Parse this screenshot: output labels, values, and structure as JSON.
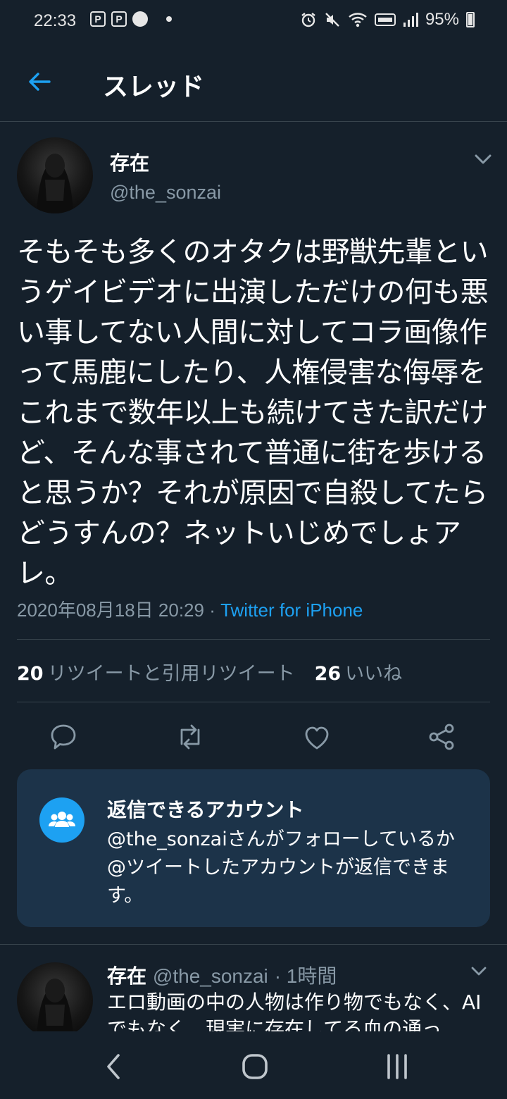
{
  "status_bar": {
    "time": "22:33",
    "notif_icons": [
      "p-notification-icon",
      "p-notification-icon",
      "sports-icon"
    ],
    "battery": "95%"
  },
  "header": {
    "title": "スレッド",
    "back_icon": "arrow-left-icon"
  },
  "tweet": {
    "author_name": "存在",
    "author_handle": "@the_sonzai",
    "text": "そもそも多くのオタクは野獣先輩というゲイビデオに出演しただけの何も悪い事してない人間に対してコラ画像作って馬鹿にしたり、人権侵害な侮辱をこれまで数年以上も続けてきた訳だけど、そんな事されて普通に街を歩けると思うか？それが原因で自殺してたらどうすんの？ネットいじめでしょアレ。",
    "timestamp": "2020年08月18日 20:29",
    "separator": " · ",
    "source": "Twitter for iPhone",
    "retweet_count": "20",
    "retweet_label": "リツイートと引用リツイート",
    "like_count": "26",
    "like_label": "いいね"
  },
  "reply_notice": {
    "title": "返信できるアカウント",
    "body": "@the_sonzaiさんがフォローしているか@ツイートしたアカウントが返信できます。"
  },
  "reply_tweet": {
    "author_name": "存在",
    "author_handle": "@the_sonzai",
    "time": "· 1時間",
    "text": "エロ動画の中の人物は作り物でもなく、AIでもなく、現実に存在してる血の通っ"
  },
  "colors": {
    "background": "#15202b",
    "accent": "#1da1f2",
    "secondary_text": "#8899a6",
    "divider": "#38444d",
    "card": "#1c3349"
  }
}
